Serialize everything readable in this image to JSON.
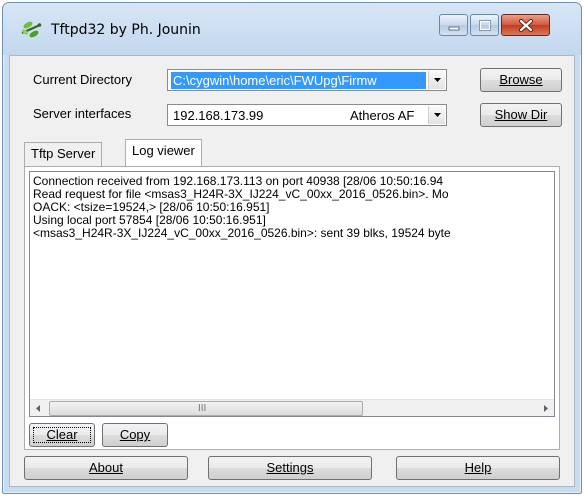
{
  "window": {
    "title": "Tftpd32 by Ph. Jounin"
  },
  "current_directory": {
    "label": "Current Directory",
    "value": "C:\\cygwin\\home\\eric\\FWUpg\\Firmw"
  },
  "server_interfaces": {
    "label": "Server interfaces",
    "ip": "192.168.173.99",
    "adapter": "Atheros AF"
  },
  "buttons": {
    "browse": "Browse",
    "show_dir": "Show Dir",
    "clear": "Clear",
    "copy": "Copy",
    "about": "About",
    "settings": "Settings",
    "help": "Help"
  },
  "tabs": [
    {
      "label": "Tftp Server",
      "active": false
    },
    {
      "label": "Log viewer",
      "active": true
    }
  ],
  "log": [
    "Connection received from 192.168.173.113 on port 40938 [28/06 10:50:16.94",
    "Read request for file <msas3_H24R-3X_IJ224_vC_00xx_2016_0526.bin>. Mo",
    "OACK: <tsize=19524,> [28/06 10:50:16.951]",
    "Using local port 57854 [28/06 10:50:16.951]",
    "<msas3_H24R-3X_IJ224_vC_00xx_2016_0526.bin>: sent 39 blks, 19524 byte"
  ],
  "scrollbar": {
    "grip": "III"
  },
  "colors": {
    "selection": "#3399ff",
    "frame": "#c9dbef",
    "close_button": "#c13d22"
  },
  "icons": {
    "app": "tftpd32-dragonfly-icon",
    "minimize": "minimize-icon",
    "maximize": "maximize-icon",
    "close": "close-icon"
  }
}
